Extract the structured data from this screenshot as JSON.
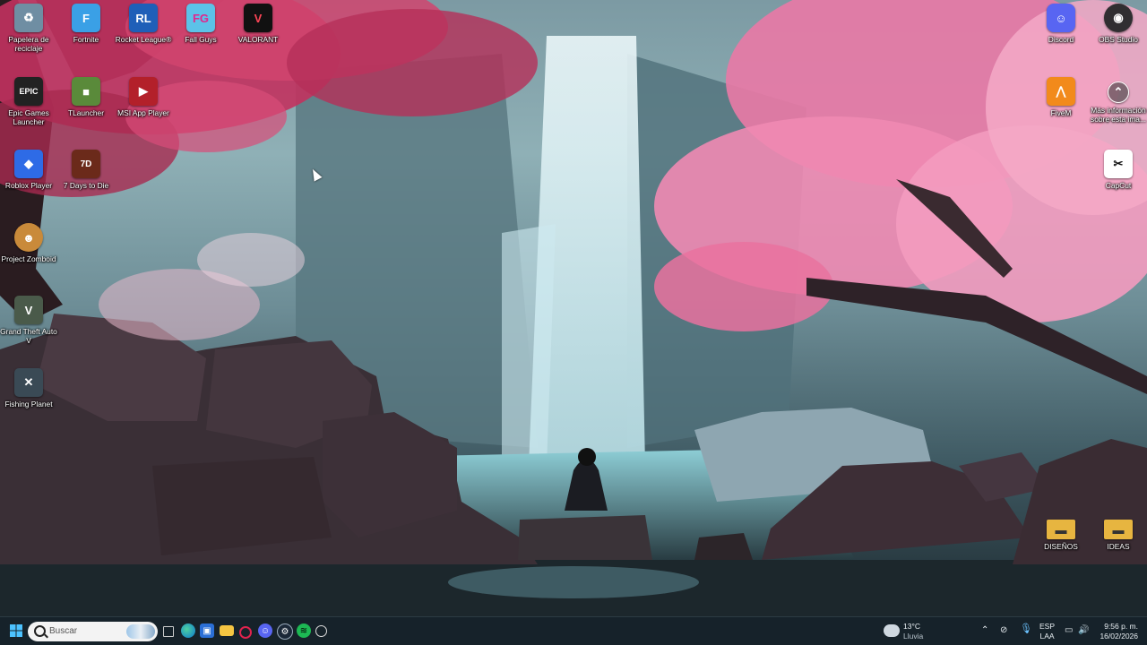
{
  "desktop": {
    "icons": [
      {
        "label": "Papelera de reciclaje",
        "icon": "recycle-bin-icon",
        "color": "#8aa6b8"
      },
      {
        "label": "Fortnite",
        "icon": "fortnite-icon",
        "color": "#3aa0e6"
      },
      {
        "label": "Rocket League®",
        "icon": "rocket-league-icon",
        "color": "#1f5fb8"
      },
      {
        "label": "Fall Guys",
        "icon": "fall-guys-icon",
        "color": "#5cc2e8"
      },
      {
        "label": "VALORANT",
        "icon": "valorant-icon",
        "color": "#fd4556"
      },
      {
        "label": "Epic Games Launcher",
        "icon": "epic-games-icon",
        "color": "#222222"
      },
      {
        "label": "TLauncher",
        "icon": "tlauncher-icon",
        "color": "#5a8a3a"
      },
      {
        "label": "MSI App Player",
        "icon": "msi-app-player-icon",
        "color": "#b3202a"
      },
      {
        "label": "Roblox Player",
        "icon": "roblox-icon",
        "color": "#2e6be6"
      },
      {
        "label": "7 Days to Die",
        "icon": "seven-days-to-die-icon",
        "color": "#6b2a1a"
      },
      {
        "label": "Project Zomboid",
        "icon": "project-zomboid-icon",
        "color": "#c98a3a"
      },
      {
        "label": "Grand Theft Auto V",
        "icon": "gta-v-icon",
        "color": "#4a5a4a"
      },
      {
        "label": "Fishing Planet",
        "icon": "fishing-planet-icon",
        "color": "#3a4a55"
      },
      {
        "label": "Discord",
        "icon": "discord-icon",
        "color": "#5865f2"
      },
      {
        "label": "OBS Studio",
        "icon": "obs-studio-icon",
        "color": "#302e31"
      },
      {
        "label": "FiveM",
        "icon": "fivem-icon",
        "color": "#f28a1b"
      },
      {
        "label": "Más información sobre esta ima...",
        "icon": "spotlight-info-icon",
        "color": "#555555"
      },
      {
        "label": "CapCut",
        "icon": "capcut-icon",
        "color": "#111111"
      },
      {
        "label": "DISEÑOS",
        "icon": "folder-icon",
        "color": "#e7b540"
      },
      {
        "label": "IDEAS",
        "icon": "folder-icon",
        "color": "#e7b540"
      }
    ]
  },
  "taskbar": {
    "search_placeholder": "Buscar",
    "pinned": [
      "windows-start-icon",
      "task-view-icon",
      "edge-icon",
      "microsoft-store-icon",
      "file-explorer-icon",
      "opera-gx-icon",
      "discord-icon",
      "steam-icon",
      "spotify-icon",
      "chrome-icon"
    ],
    "weather": {
      "temp": "13°C",
      "condition": "Lluvia"
    },
    "language": {
      "code": "ESP",
      "layout": "LAA"
    },
    "clock": {
      "time": "9:56 p. m.",
      "date": "16/02/2026"
    }
  }
}
